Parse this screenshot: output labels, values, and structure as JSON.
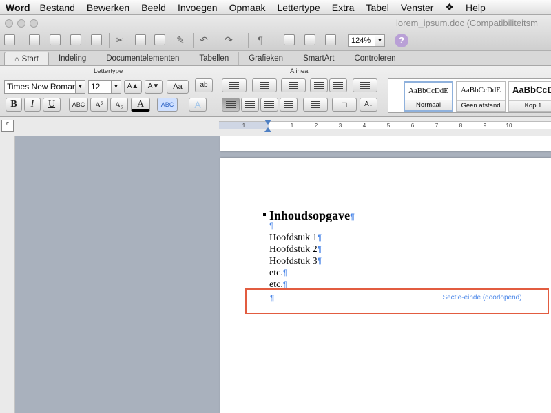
{
  "menu": {
    "app": "Word",
    "items": [
      "Bestand",
      "Bewerken",
      "Beeld",
      "Invoegen",
      "Opmaak",
      "Lettertype",
      "Extra",
      "Tabel",
      "Venster",
      "Help"
    ]
  },
  "window": {
    "title": "lorem_ipsum.doc (Compatibiliteitsm"
  },
  "toolbar": {
    "zoom": "124%",
    "help_glyph": "?"
  },
  "tabs": [
    "Start",
    "Indeling",
    "Documentelementen",
    "Tabellen",
    "Grafieken",
    "SmartArt",
    "Controleren"
  ],
  "ribbon": {
    "font_group_label": "Lettertype",
    "para_group_label": "Alinea",
    "font_name": "Times New Roman",
    "font_size": "12",
    "bold": "B",
    "italic": "I",
    "underline": "U",
    "strike": "ABC",
    "superscript": "A²",
    "subscript": "A₂",
    "font_color": "A",
    "highlight": "ABC",
    "grow": "A▲",
    "shrink": "A▼",
    "case": "Aa",
    "styles": [
      {
        "sample": "AaBbCcDdE",
        "name": "Normaal"
      },
      {
        "sample": "AaBbCcDdE",
        "name": "Geen afstand"
      },
      {
        "sample": "AaBbCcD",
        "name": "Kop 1"
      }
    ]
  },
  "ruler": {
    "ticks": [
      "1",
      "1",
      "2",
      "3",
      "4",
      "5",
      "6",
      "7",
      "8",
      "9",
      "10"
    ]
  },
  "document": {
    "heading": "Inhoudsopgave",
    "pilcrow": "¶",
    "lines": [
      "Hoofdstuk 1",
      "Hoofdstuk 2",
      "Hoofdstuk 3",
      "etc.",
      "etc."
    ],
    "section_break": "Sectie-einde (doorlopend)"
  }
}
